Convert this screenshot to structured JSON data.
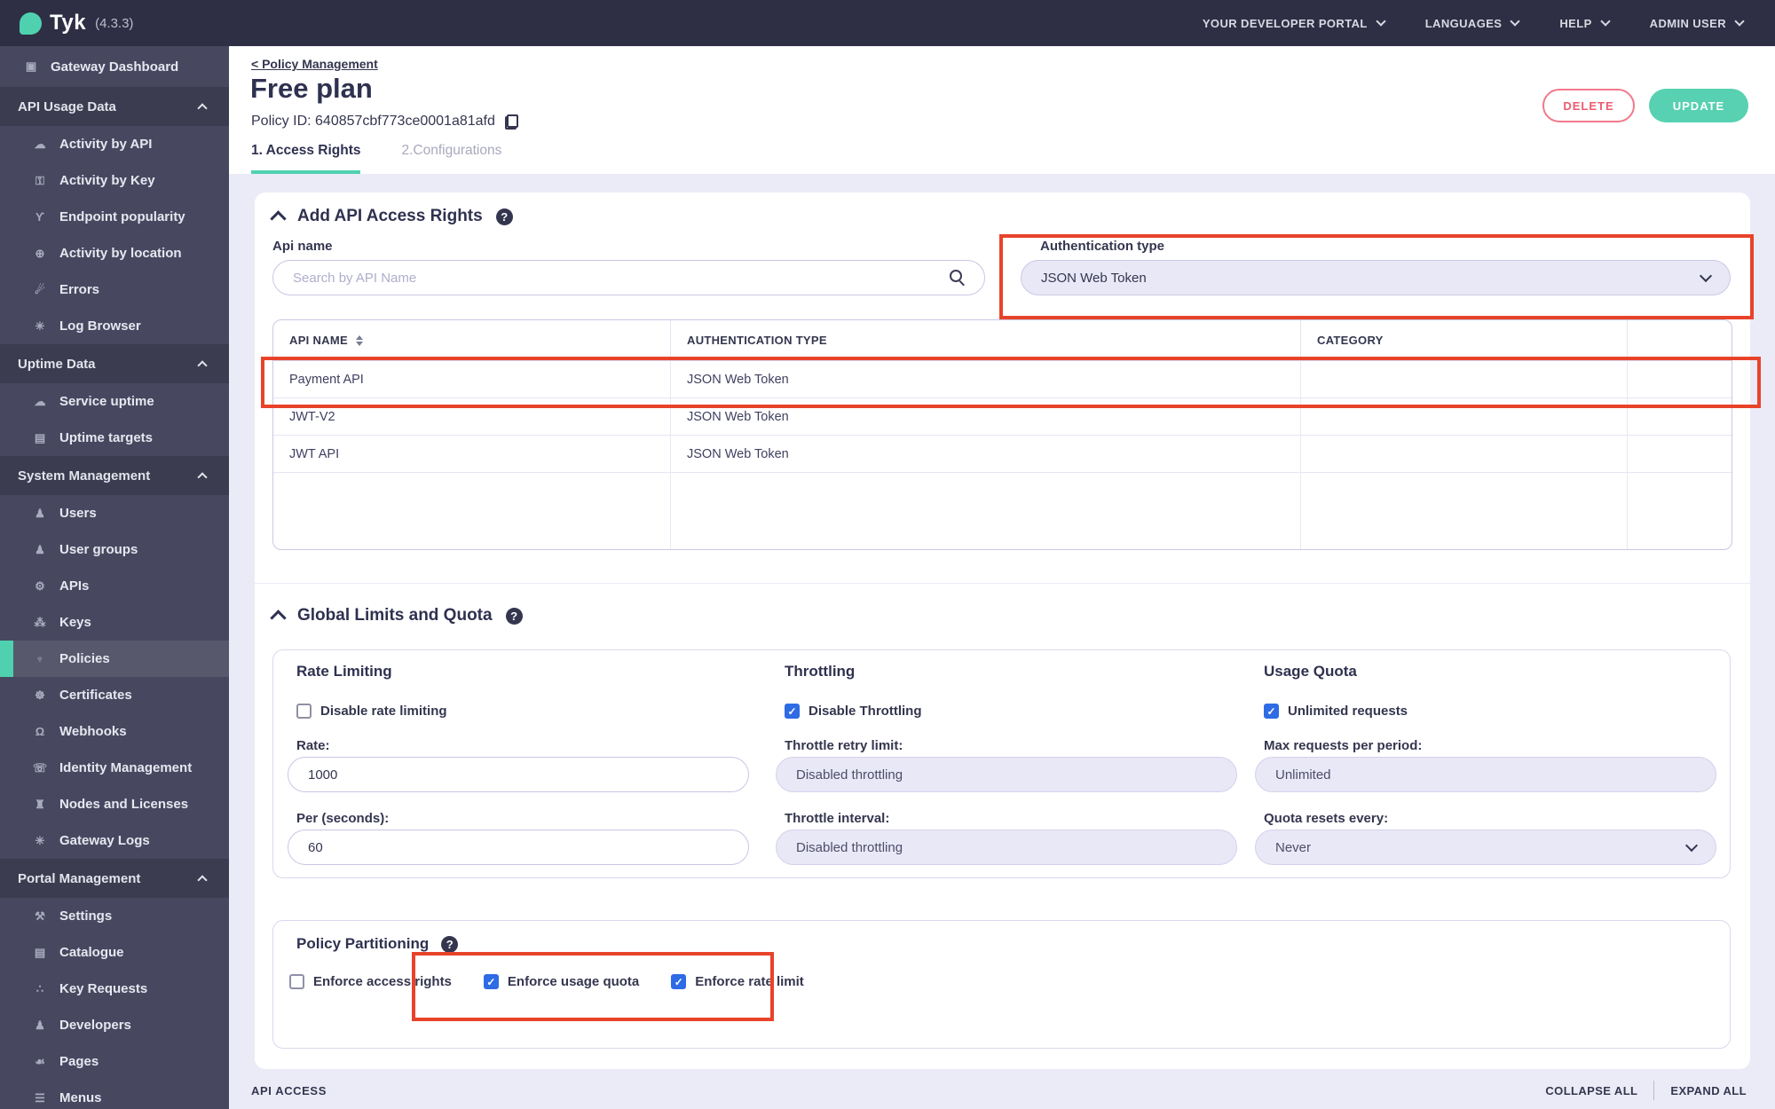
{
  "topbar": {
    "brand": "Tyk",
    "version": "(4.3.3)",
    "menus": [
      {
        "label": "YOUR DEVELOPER PORTAL"
      },
      {
        "label": "LANGUAGES"
      },
      {
        "label": "HELP"
      },
      {
        "label": "ADMIN USER"
      }
    ]
  },
  "sidebar": {
    "items": [
      {
        "type": "item",
        "label": "Gateway Dashboard",
        "icon": "monitor",
        "root": true
      },
      {
        "type": "section",
        "label": "API Usage Data"
      },
      {
        "type": "item",
        "label": "Activity by API",
        "icon": "cloud"
      },
      {
        "type": "item",
        "label": "Activity by Key",
        "icon": "key"
      },
      {
        "type": "item",
        "label": "Endpoint popularity",
        "icon": "branch"
      },
      {
        "type": "item",
        "label": "Activity by location",
        "icon": "globe"
      },
      {
        "type": "item",
        "label": "Errors",
        "icon": "bomb"
      },
      {
        "type": "item",
        "label": "Log Browser",
        "icon": "bug"
      },
      {
        "type": "section",
        "label": "Uptime Data"
      },
      {
        "type": "item",
        "label": "Service uptime",
        "icon": "cloud"
      },
      {
        "type": "item",
        "label": "Uptime targets",
        "icon": "list"
      },
      {
        "type": "section",
        "label": "System Management"
      },
      {
        "type": "item",
        "label": "Users",
        "icon": "user"
      },
      {
        "type": "item",
        "label": "User groups",
        "icon": "users"
      },
      {
        "type": "item",
        "label": "APIs",
        "icon": "gears"
      },
      {
        "type": "item",
        "label": "Keys",
        "icon": "network"
      },
      {
        "type": "item",
        "label": "Policies",
        "icon": "plug",
        "active": true
      },
      {
        "type": "item",
        "label": "Certificates",
        "icon": "seal"
      },
      {
        "type": "item",
        "label": "Webhooks",
        "icon": "bell"
      },
      {
        "type": "item",
        "label": "Identity Management",
        "icon": "phone"
      },
      {
        "type": "item",
        "label": "Nodes and Licenses",
        "icon": "building"
      },
      {
        "type": "item",
        "label": "Gateway Logs",
        "icon": "bug"
      },
      {
        "type": "section",
        "label": "Portal Management"
      },
      {
        "type": "item",
        "label": "Settings",
        "icon": "wrench"
      },
      {
        "type": "item",
        "label": "Catalogue",
        "icon": "list"
      },
      {
        "type": "item",
        "label": "Key Requests",
        "icon": "paw"
      },
      {
        "type": "item",
        "label": "Developers",
        "icon": "users"
      },
      {
        "type": "item",
        "label": "Pages",
        "icon": "leaf"
      },
      {
        "type": "item",
        "label": "Menus",
        "icon": "menu"
      }
    ]
  },
  "header": {
    "breadcrumb": "< Policy Management",
    "title": "Free plan",
    "policy_id": "Policy ID: 640857cbf773ce0001a81afd",
    "tabs": [
      {
        "label": "1. Access Rights",
        "active": true
      },
      {
        "label": "2.Configurations",
        "active": false
      }
    ],
    "delete_label": "DELETE",
    "update_label": "UPDATE"
  },
  "access_rights": {
    "heading": "Add API Access Rights",
    "api_name_label": "Api name",
    "search_placeholder": "Search by API Name",
    "auth_type_label": "Authentication type",
    "auth_type_value": "JSON Web Token",
    "table": {
      "columns": [
        "API NAME",
        "AUTHENTICATION TYPE",
        "CATEGORY"
      ],
      "rows": [
        {
          "name": "Payment API",
          "auth": "JSON Web Token",
          "category": ""
        },
        {
          "name": "JWT-V2",
          "auth": "JSON Web Token",
          "category": ""
        },
        {
          "name": "JWT API",
          "auth": "JSON Web Token",
          "category": ""
        }
      ]
    }
  },
  "limits": {
    "heading": "Global Limits and Quota",
    "rate": {
      "title": "Rate Limiting",
      "checkbox": "Disable rate limiting",
      "checked": false,
      "fields": [
        {
          "label": "Rate:",
          "value": "1000"
        },
        {
          "label": "Per (seconds):",
          "value": "60"
        }
      ]
    },
    "throttling": {
      "title": "Throttling",
      "checkbox": "Disable Throttling",
      "checked": true,
      "fields": [
        {
          "label": "Throttle retry limit:",
          "value": "Disabled throttling"
        },
        {
          "label": "Throttle interval:",
          "value": "Disabled throttling"
        }
      ]
    },
    "quota": {
      "title": "Usage Quota",
      "checkbox": "Unlimited requests",
      "checked": true,
      "fields": [
        {
          "label": "Max requests per period:",
          "value": "Unlimited"
        },
        {
          "label": "Quota resets every:",
          "value": "Never"
        }
      ]
    }
  },
  "partitioning": {
    "heading": "Policy Partitioning",
    "checkboxes": [
      {
        "label": "Enforce access rights",
        "checked": false
      },
      {
        "label": "Enforce usage quota",
        "checked": true
      },
      {
        "label": "Enforce rate limit",
        "checked": true
      }
    ]
  },
  "footer": {
    "left": "API ACCESS",
    "collapse": "COLLAPSE ALL",
    "expand": "EXPAND ALL"
  },
  "colors": {
    "accent_teal": "#4fd1b0",
    "danger_red": "#ee5a6f",
    "annotation_red": "#e8432a",
    "checkbox_blue": "#2e6be4",
    "topbar_bg": "#2e2f44",
    "sidebar_bg": "#474860"
  }
}
